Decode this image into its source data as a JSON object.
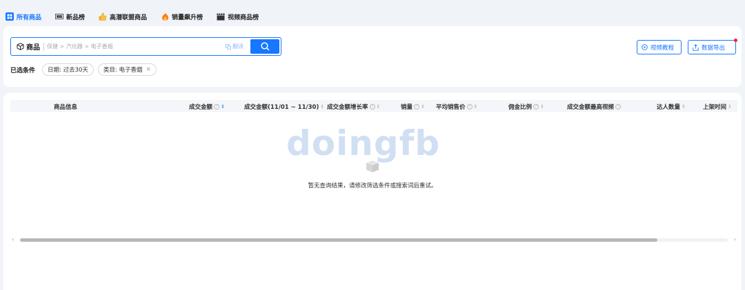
{
  "tabs": [
    {
      "label": "所有商品",
      "icon": "grid-icon",
      "active": true
    },
    {
      "label": "新品榜",
      "icon": "new-badge-icon",
      "active": false
    },
    {
      "label": "高潜联盟商品",
      "icon": "thumbs-up-icon",
      "active": false
    },
    {
      "label": "销量飙升榜",
      "icon": "fire-icon",
      "active": false
    },
    {
      "label": "视频商品榜",
      "icon": "clapperboard-icon",
      "active": false
    }
  ],
  "search": {
    "kind_label": "商品",
    "placeholder": "保健 > 汽化器 > 电子香烟",
    "value": "",
    "translate_label": "翻译"
  },
  "actions": {
    "tutorial_label": "视频教程",
    "export_label": "数据导出"
  },
  "filters": {
    "label": "已选条件",
    "chips": [
      "日期: 过去30天",
      "类目: 电子香烟"
    ]
  },
  "table": {
    "columns": [
      {
        "label": "商品信息"
      },
      {
        "label": "成交金额",
        "help": true,
        "sort": "active"
      },
      {
        "label": "成交金额(11/01 ~ 11/30)",
        "sort": "default"
      },
      {
        "label": "成交金额增长率",
        "help": true,
        "sort": "default"
      },
      {
        "label": "销量",
        "help": true,
        "sort": "default"
      },
      {
        "label": "平均销售价",
        "help": true,
        "sort": "default"
      },
      {
        "label": "佣金比例",
        "help": true,
        "sort": "default"
      },
      {
        "label": "成交金额最高视频",
        "help": true
      },
      {
        "label": "达人数量",
        "sort": "default"
      },
      {
        "label": "上架时间",
        "sort": "default"
      }
    ],
    "watermark": "doingfb",
    "empty_message": "暂无查询结果，请修改筛选条件或搜索词后重试。"
  },
  "colors": {
    "accent": "#1677ff",
    "background": "#f0f3f7",
    "notice_dot": "#f5222d"
  }
}
